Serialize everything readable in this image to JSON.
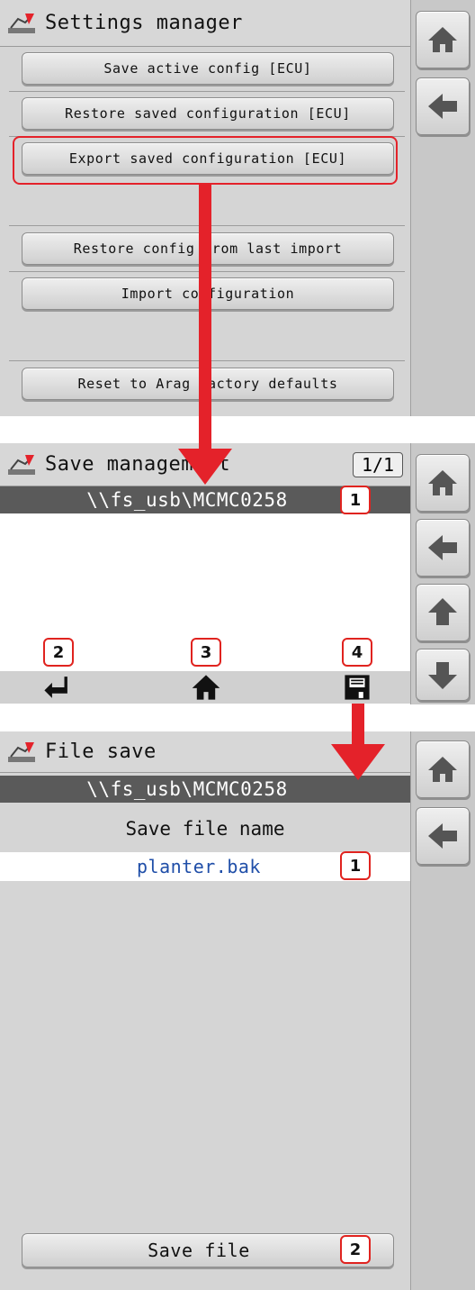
{
  "screen1": {
    "title": "Settings manager",
    "buttons": [
      "Save active config [ECU]",
      "Restore saved configuration [ECU]",
      "Export saved configuration [ECU]",
      "Restore config from last import",
      "Import configuration",
      "Reset to Arag factory defaults"
    ],
    "side_icons": [
      "home-icon",
      "back-arrow-icon"
    ]
  },
  "screen2": {
    "title": "Save management",
    "page_counter": "1/1",
    "path": "\\\\fs_usb\\MCMC0258",
    "path_badge": "1",
    "bottom_badges": [
      "2",
      "3",
      "4"
    ],
    "bottom_icons": [
      "return-icon",
      "home-icon",
      "floppy-disk-icon"
    ],
    "side_icons": [
      "home-icon",
      "back-arrow-icon",
      "up-arrow-icon",
      "down-arrow-icon"
    ]
  },
  "screen3": {
    "title": "File save",
    "path": "\\\\fs_usb\\MCMC0258",
    "label": "Save file name",
    "file_name": "planter.bak",
    "file_badge": "1",
    "save_button": "Save file",
    "save_badge": "2",
    "side_icons": [
      "home-icon",
      "back-arrow-icon"
    ]
  },
  "colors": {
    "highlight": "#e4222a",
    "path_bar": "#5a5a5a",
    "file_name_text": "#1f4ea8",
    "panel": "#d5d5d5"
  }
}
